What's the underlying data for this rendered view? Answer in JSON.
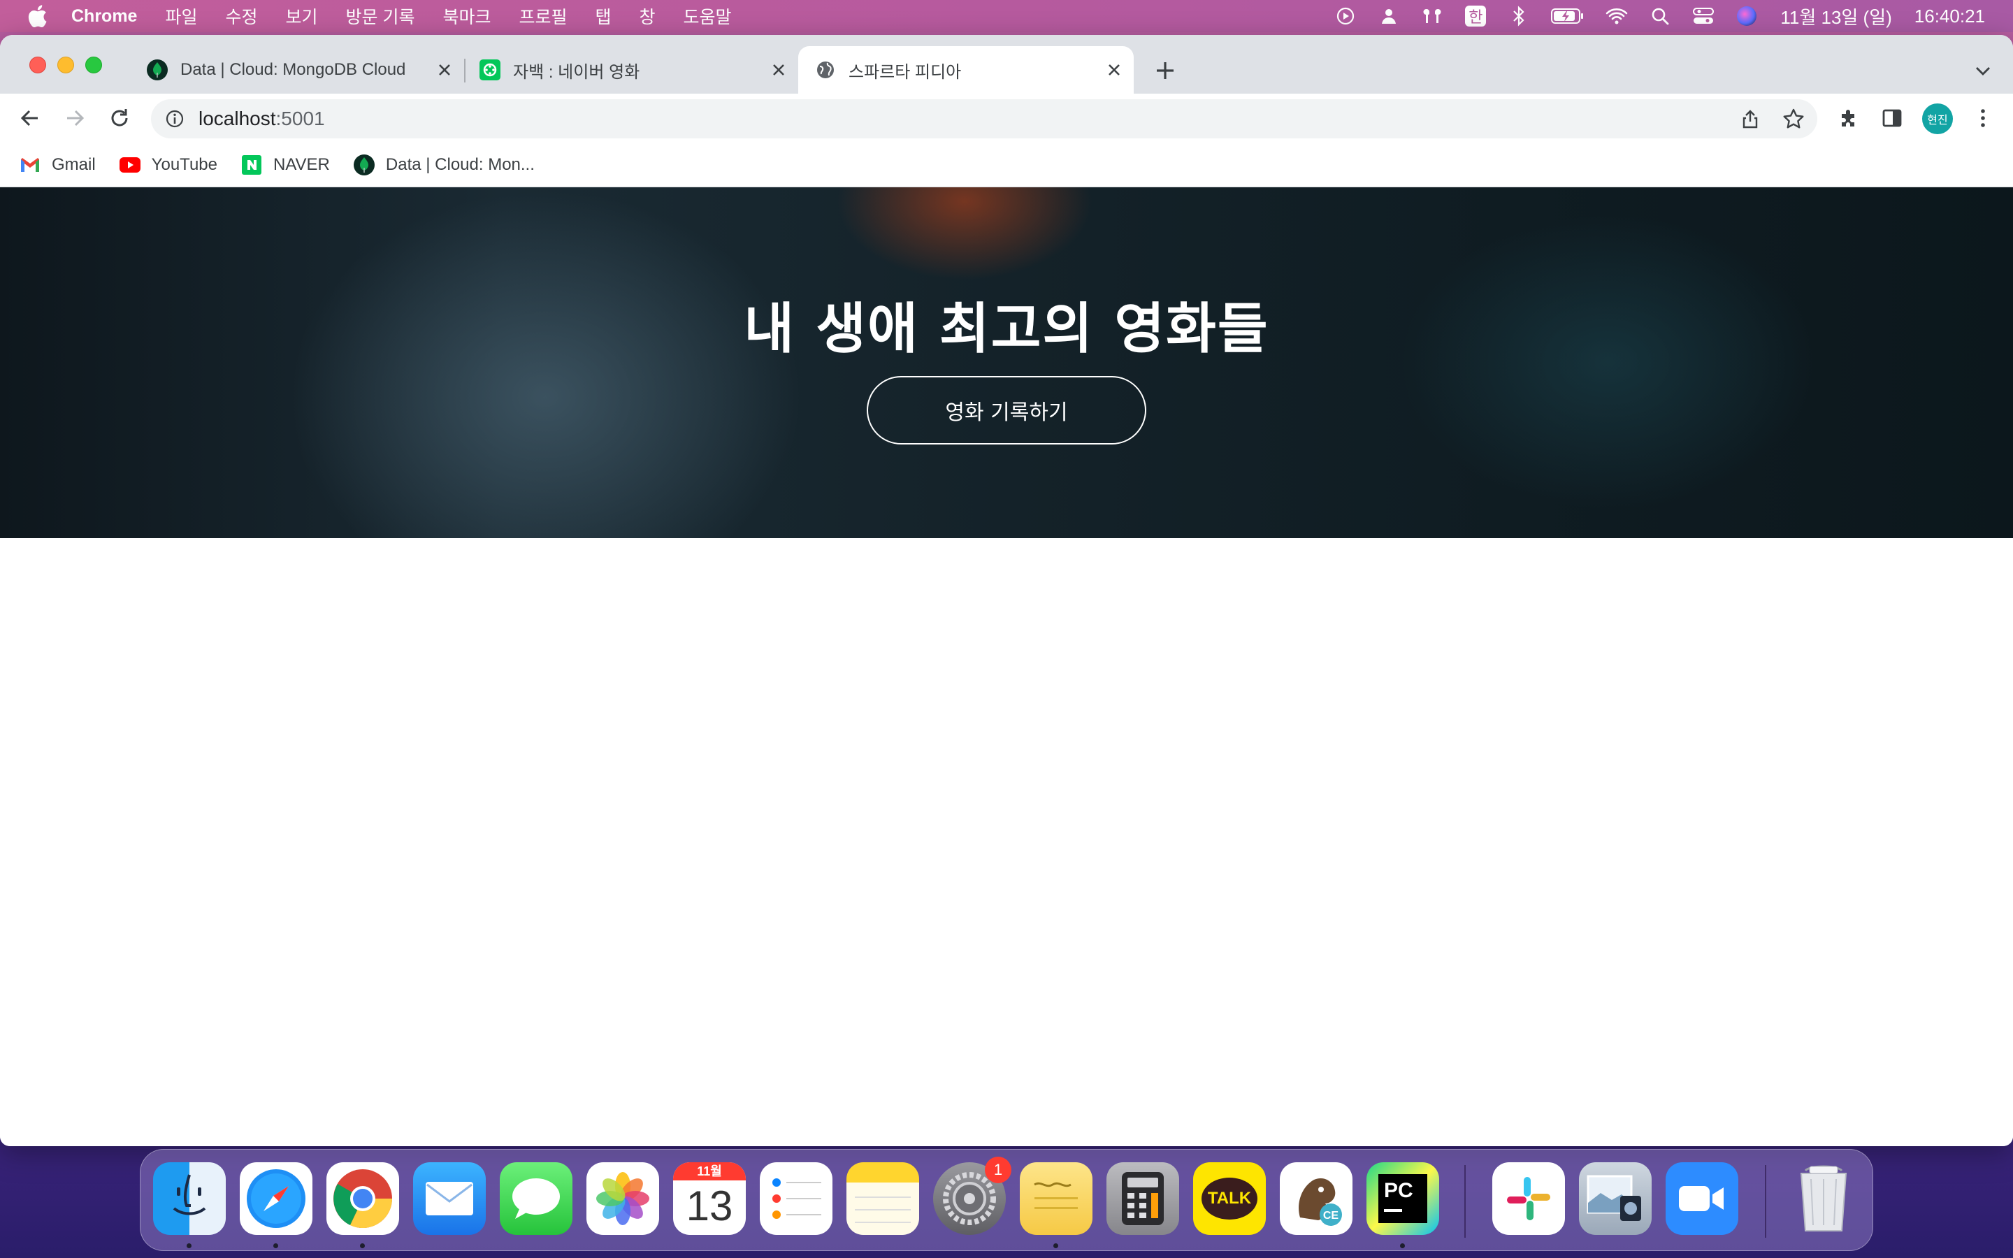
{
  "menubar": {
    "app_name": "Chrome",
    "items": [
      "파일",
      "수정",
      "보기",
      "방문 기록",
      "북마크",
      "프로필",
      "탭",
      "창",
      "도움말"
    ],
    "input_method": "한",
    "date": "11월 13일 (일)",
    "time": "16:40:21"
  },
  "tabs": [
    {
      "title": "Data | Cloud: MongoDB Cloud",
      "icon": "mongodb-leaf-icon"
    },
    {
      "title": "자백 : 네이버 영화",
      "icon": "naver-movie-icon"
    },
    {
      "title": "스파르타 피디아",
      "icon": "globe-icon"
    }
  ],
  "address_bar": {
    "host": "localhost",
    "port": ":5001"
  },
  "profile": {
    "initials": "현진",
    "color": "#12a4a4"
  },
  "bookmarks": [
    {
      "label": "Gmail",
      "icon": "gmail-icon"
    },
    {
      "label": "YouTube",
      "icon": "youtube-icon"
    },
    {
      "label": "NAVER",
      "icon": "naver-icon"
    },
    {
      "label": "Data | Cloud: Mon...",
      "icon": "mongodb-leaf-icon"
    }
  ],
  "hero": {
    "title": "내 생애 최고의 영화들",
    "button_label": "영화 기록하기"
  },
  "dock": {
    "calendar_month": "11월",
    "calendar_day": "13",
    "settings_badge": "1",
    "kakaotalk_label": "TALK",
    "pycharm_label": "PC"
  }
}
